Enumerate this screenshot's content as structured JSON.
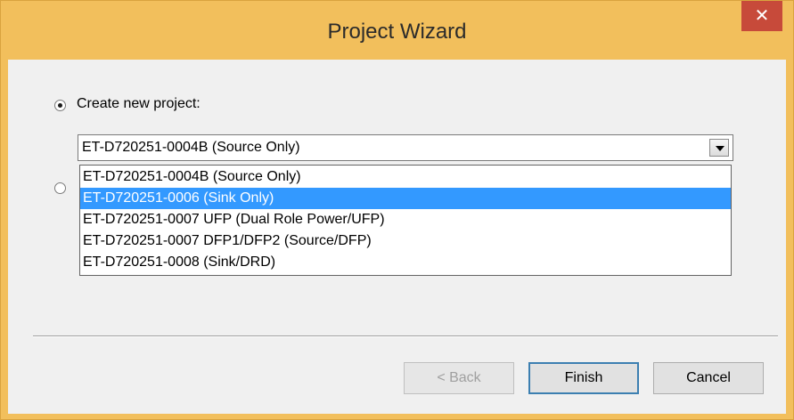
{
  "window": {
    "title": "Project Wizard",
    "close_glyph": "✕"
  },
  "options": {
    "create_new_label": "Create new project:",
    "create_new_checked": true,
    "open_existing_checked": false
  },
  "combo": {
    "value": "ET-D720251-0004B (Source Only)",
    "items": [
      "ET-D720251-0004B (Source Only)",
      "ET-D720251-0006 (Sink Only)",
      "ET-D720251-0007 UFP (Dual Role Power/UFP)",
      "ET-D720251-0007 DFP1/DFP2 (Source/DFP)",
      "ET-D720251-0008 (Sink/DRD)"
    ],
    "highlighted_index": 1
  },
  "buttons": {
    "back_label": "< Back",
    "finish_label": "Finish",
    "cancel_label": "Cancel"
  },
  "colors": {
    "titlebar": "#f2bf5c",
    "close": "#c74a3a",
    "highlight": "#3399ff"
  },
  "icons": {
    "close": "close-icon",
    "dropdown": "chevron-down-icon"
  }
}
